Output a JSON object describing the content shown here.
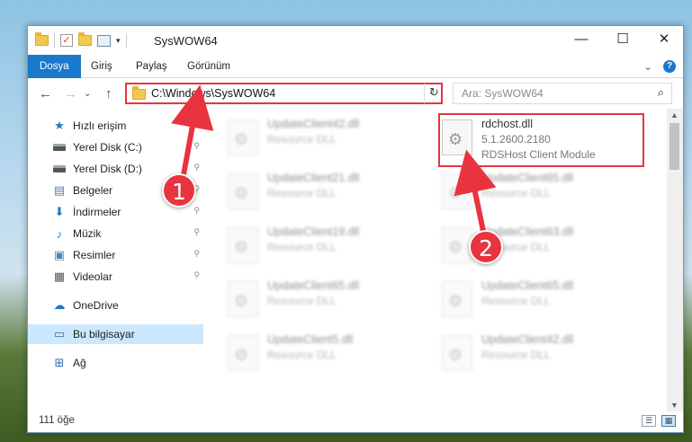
{
  "window": {
    "title": "SysWOW64",
    "controls": {
      "minimize": "—",
      "maximize": "☐",
      "close": "✕"
    }
  },
  "ribbon": {
    "tabs": [
      {
        "label": "Dosya",
        "active": true
      },
      {
        "label": "Giriş"
      },
      {
        "label": "Paylaş"
      },
      {
        "label": "Görünüm"
      }
    ],
    "help": "?",
    "expand": "⌄"
  },
  "nav": {
    "back": "←",
    "forward": "→",
    "recent": "⌄",
    "up": "↑",
    "address": "C:\\Windows\\SysWOW64",
    "address_dropdown": "⌄",
    "refresh": "↻",
    "search_placeholder": "Ara: SysWOW64",
    "search_icon": "⌕"
  },
  "sidebar": {
    "items": [
      {
        "label": "Hızlı erişim",
        "icon": "star-icon",
        "glyph": "★",
        "color": "#1979ca"
      },
      {
        "label": "Yerel Disk (C:)",
        "icon": "drive-icon",
        "pinned": true
      },
      {
        "label": "Yerel Disk (D:)",
        "icon": "drive-icon",
        "pinned": true
      },
      {
        "label": "Belgeler",
        "icon": "documents-icon",
        "glyph": "▤",
        "color": "#5b7fa6",
        "pinned": true
      },
      {
        "label": "İndirmeler",
        "icon": "download-icon",
        "glyph": "⬇",
        "color": "#1979ca",
        "pinned": true
      },
      {
        "label": "Müzik",
        "icon": "music-icon",
        "glyph": "♪",
        "color": "#1979ca",
        "pinned": true
      },
      {
        "label": "Resimler",
        "icon": "pictures-icon",
        "glyph": "▣",
        "color": "#4a86b8",
        "pinned": true
      },
      {
        "label": "Videolar",
        "icon": "videos-icon",
        "glyph": "▦",
        "color": "#555",
        "pinned": true
      },
      {
        "label": "OneDrive",
        "icon": "cloud-icon",
        "glyph": "☁",
        "color": "#1979ca"
      },
      {
        "label": "Bu bilgisayar",
        "icon": "computer-icon",
        "glyph": "▭",
        "color": "#2b6fb0",
        "selected": true
      },
      {
        "label": "Ağ",
        "icon": "network-icon",
        "glyph": "⊞",
        "color": "#2b6fb0"
      }
    ],
    "pin_glyph": "📌"
  },
  "files": [
    {
      "name": "UpdateClient42.dll",
      "type": "Resource DLL",
      "blurred": true
    },
    {
      "name": "rdchost.dll",
      "type": "5.1.2600.2180",
      "desc": "RDSHost Client Module",
      "blurred": false
    },
    {
      "name": "UpdateClient21.dll",
      "type": "Resource DLL",
      "blurred": true
    },
    {
      "name": "UpdateClient65.dll",
      "type": "Resource DLL",
      "blurred": true
    },
    {
      "name": "UpdateClient19.dll",
      "type": "Resource DLL",
      "blurred": true
    },
    {
      "name": "UpdateClient63.dll",
      "type": "Resource DLL",
      "blurred": true
    },
    {
      "name": "UpdateClient65.dll",
      "type": "Resource DLL",
      "blurred": true
    },
    {
      "name": "UpdateClient65.dll",
      "type": "Resource DLL",
      "blurred": true
    },
    {
      "name": "UpdateClient5.dll",
      "type": "Resource DLL",
      "blurred": true
    },
    {
      "name": "UpdateClient42.dll",
      "type": "Resource DLL",
      "blurred": true
    }
  ],
  "status": {
    "count": "111 öğe",
    "view_details": "☰",
    "view_tiles": "▦"
  },
  "annotations": {
    "marker1": "1",
    "marker2": "2",
    "color": "#e8343f"
  }
}
